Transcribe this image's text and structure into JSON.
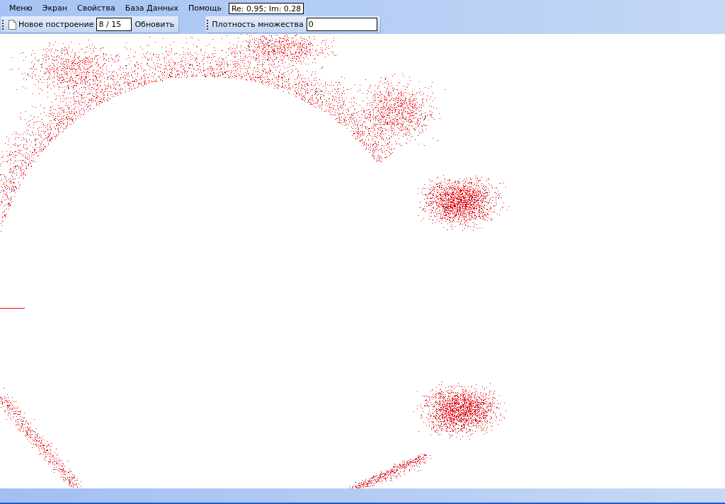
{
  "menu": [
    {
      "label": "Меню"
    },
    {
      "label": "Экран"
    },
    {
      "label": "Свойства"
    },
    {
      "label": "База Данных"
    },
    {
      "label": "Помощь"
    }
  ],
  "coordinate_readout": "Re: 0,95; Im: 0,28",
  "toolbar_build": {
    "button": "Новое построение",
    "step_field": "8 / 15",
    "refresh_button": "Обновить"
  },
  "toolbar_density": {
    "label": "Плотность множества",
    "value": "0"
  }
}
